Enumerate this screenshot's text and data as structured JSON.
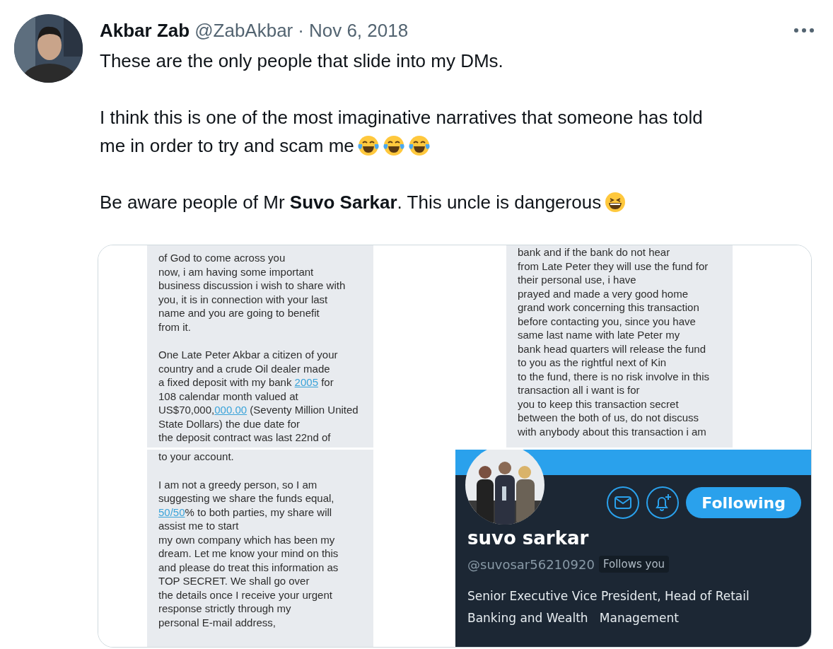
{
  "tweet": {
    "author": {
      "name": "Akbar Zab",
      "handle": "@ZabAkbar",
      "separator": "·",
      "date": "Nov 6, 2018"
    },
    "paragraphs": [
      {
        "lines": [
          "These are the only people that slide into my DMs."
        ]
      },
      {
        "lines": [
          "I think this is one of the most imaginative narratives that someone has told",
          "me in order to try and scam me"
        ],
        "emojis": [
          {
            "kind": "tears_of_joy"
          },
          {
            "kind": "tears_of_joy"
          },
          {
            "kind": "tears_of_joy"
          }
        ]
      },
      {
        "lines": [
          "Be aware people of Mr **Suvo Sarkar**. This uncle is dangerous"
        ],
        "emojis": [
          {
            "kind": "grinning"
          }
        ]
      }
    ],
    "media": {
      "panels": [
        {
          "kind": "message",
          "paragraphs": [
            [
              "of God to come across you",
              "now, i am having some important",
              "business discussion i wish to share with",
              "you, it is in connection with your last",
              "name and you are going to benefit",
              "from it."
            ],
            [
              "One Late Peter Akbar a citizen of your",
              "country and a crude Oil dealer made",
              {
                "segments": [
                  "a fixed deposit with my bank ",
                  {
                    "link": "2005"
                  },
                  " for"
                ]
              },
              "108 calendar month valued at",
              {
                "segments": [
                  "US$70,000,",
                  {
                    "link": "000.00"
                  },
                  " (Seventy Million United"
                ]
              },
              "State Dollars) the due date for",
              "the deposit contract was last 22nd of"
            ]
          ]
        },
        {
          "kind": "message",
          "paragraphs": [
            [
              "bank and if the bank do not hear",
              "from Late Peter they will use the fund for",
              "their personal use, i have",
              "prayed and made a very good home",
              "grand work concerning this transaction",
              "before contacting you, since you have",
              "same last name with late Peter my",
              "bank head quarters will release the fund",
              "to you as the rightful next of Kin",
              "to the fund, there is no risk involve in this",
              "transaction all i want is for",
              "you to keep this transaction secret",
              "between the both of us, do not discuss",
              "with anybody about this transaction i am"
            ]
          ]
        },
        {
          "kind": "message",
          "paragraphs": [
            [
              "to your account."
            ],
            [
              "I am not a greedy person, so I am",
              "suggesting we share the funds equal,",
              {
                "segments": [
                  {
                    "link": "50/50"
                  },
                  "% to both parties, my share will"
                ]
              },
              "assist me to start",
              "my own company which has been my",
              "dream. Let me know your mind on this",
              "and please do treat this information as",
              "TOP SECRET. We shall go over",
              "the details once I receive your urgent",
              "response strictly through my",
              "personal E-mail address,"
            ]
          ]
        },
        {
          "kind": "profile",
          "name": "suvo sarkar",
          "handle": "@suvosar56210920",
          "follows_you": "Follows you",
          "button": "Following",
          "bio_lines": [
            "Senior Executive Vice President, Head of Retail",
            "Banking and Wealth   Management"
          ]
        }
      ]
    }
  }
}
